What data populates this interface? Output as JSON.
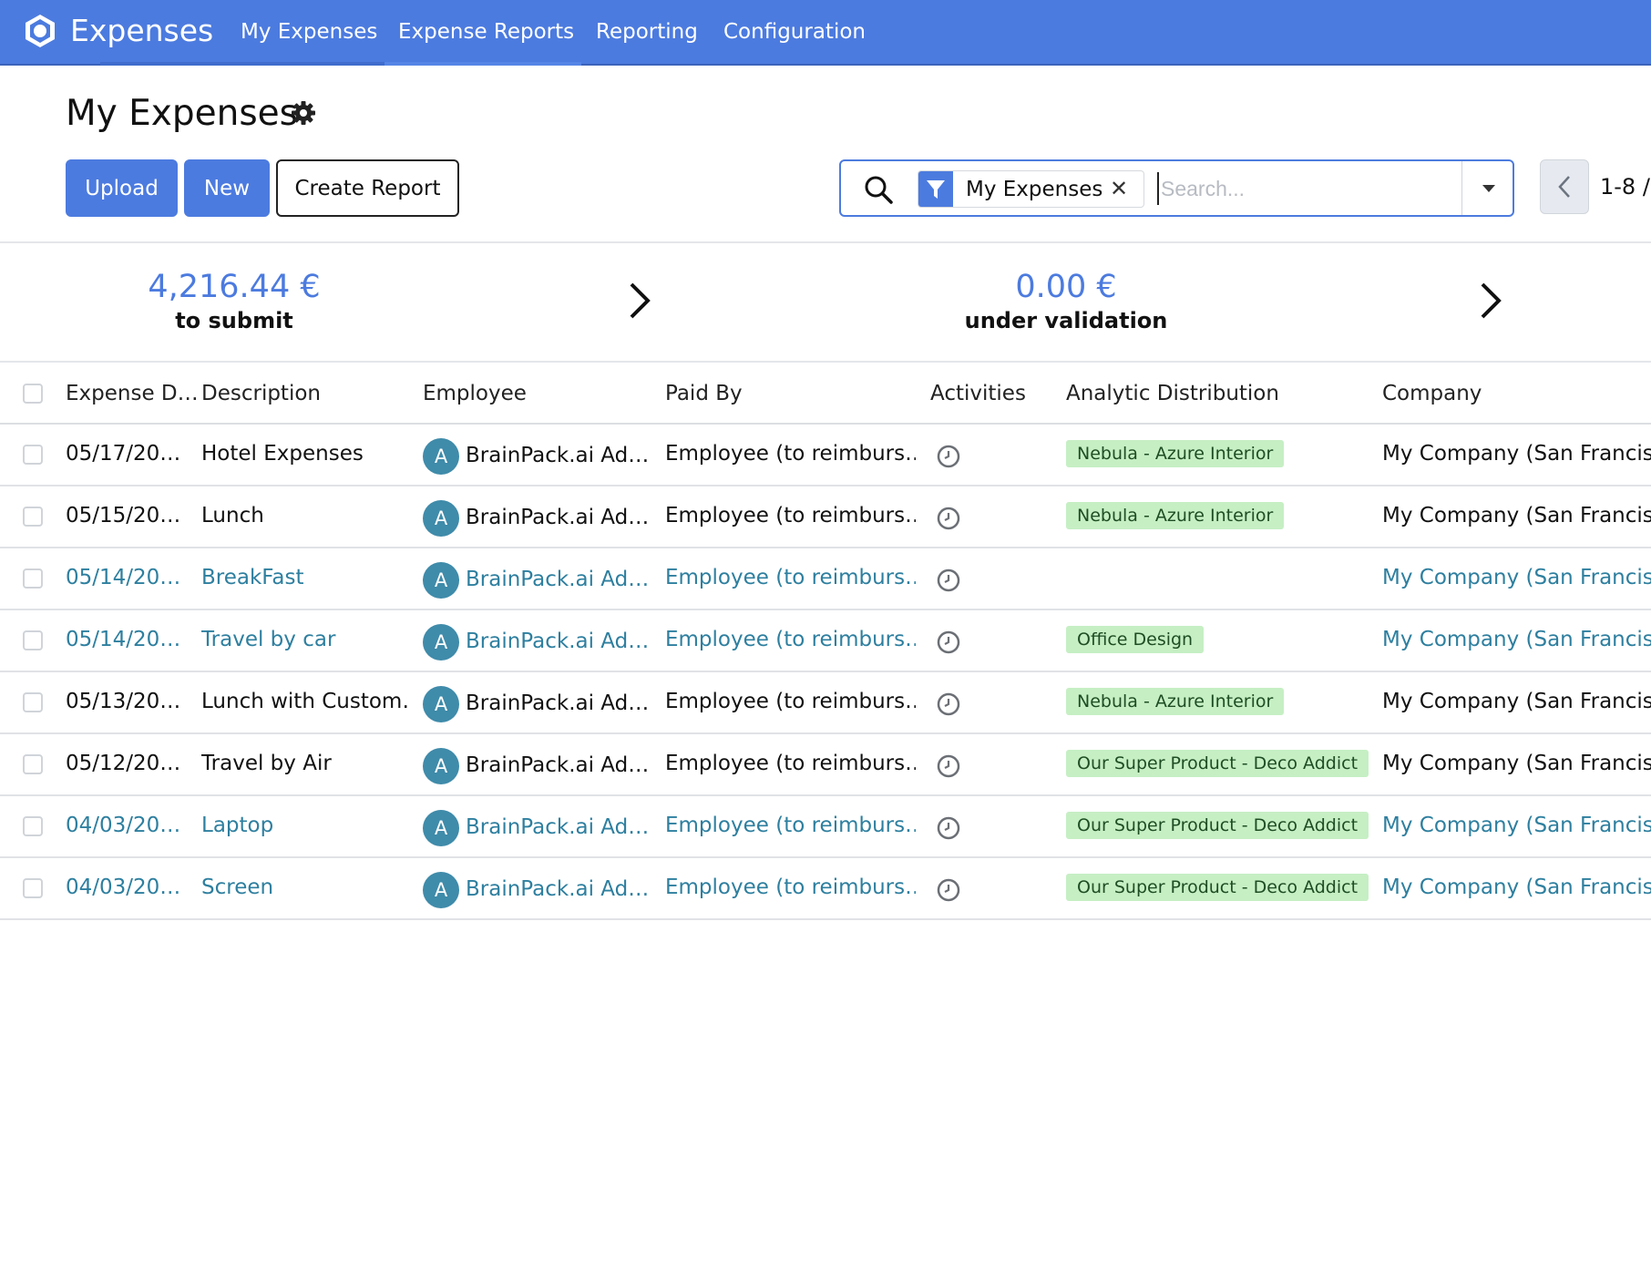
{
  "app": {
    "name": "Expenses"
  },
  "nav": [
    "My Expenses",
    "Expense Reports",
    "Reporting",
    "Configuration"
  ],
  "page": {
    "title": "My Expenses"
  },
  "buttons": {
    "upload": "Upload",
    "new": "New",
    "create_report": "Create Report"
  },
  "search": {
    "facet": "My Expenses",
    "placeholder": "Search..."
  },
  "pager": {
    "value": "1-8 /"
  },
  "summary": {
    "to_submit": {
      "amount": "4,216.44 €",
      "label": "to submit"
    },
    "under_validation": {
      "amount": "0.00 €",
      "label": "under validation"
    }
  },
  "columns": [
    "Expense D…",
    "Description",
    "Employee",
    "Paid By",
    "Activities",
    "Analytic Distribution",
    "Company"
  ],
  "rows": [
    {
      "date": "05/17/20…",
      "description": "Hotel Expenses",
      "avatar": "A",
      "employee": "BrainPack.ai Ad…",
      "paid_by": "Employee (to reimburs…",
      "analytic": "Nebula - Azure Interior",
      "company": "My Company (San Francisco",
      "style": "plain"
    },
    {
      "date": "05/15/20…",
      "description": "Lunch",
      "avatar": "A",
      "employee": "BrainPack.ai Ad…",
      "paid_by": "Employee (to reimburs…",
      "analytic": "Nebula - Azure Interior",
      "company": "My Company (San Francisco",
      "style": "plain"
    },
    {
      "date": "05/14/20…",
      "description": "BreakFast",
      "avatar": "A",
      "employee": "BrainPack.ai Ad…",
      "paid_by": "Employee (to reimburs…",
      "analytic": "",
      "company": "My Company (San Francisco",
      "style": "link"
    },
    {
      "date": "05/14/20…",
      "description": "Travel by car",
      "avatar": "A",
      "employee": "BrainPack.ai Ad…",
      "paid_by": "Employee (to reimburs…",
      "analytic": "Office Design",
      "company": "My Company (San Francisco",
      "style": "link"
    },
    {
      "date": "05/13/20…",
      "description": "Lunch with Custom…",
      "avatar": "A",
      "employee": "BrainPack.ai Ad…",
      "paid_by": "Employee (to reimburs…",
      "analytic": "Nebula - Azure Interior",
      "company": "My Company (San Francisco",
      "style": "plain"
    },
    {
      "date": "05/12/20…",
      "description": "Travel by Air",
      "avatar": "A",
      "employee": "BrainPack.ai Ad…",
      "paid_by": "Employee (to reimburs…",
      "analytic": "Our Super Product - Deco Addict",
      "company": "My Company (San Francisco",
      "style": "plain"
    },
    {
      "date": "04/03/20…",
      "description": "Laptop",
      "avatar": "A",
      "employee": "BrainPack.ai Ad…",
      "paid_by": "Employee (to reimburs…",
      "analytic": "Our Super Product - Deco Addict",
      "company": "My Company (San Francisco",
      "style": "link"
    },
    {
      "date": "04/03/20…",
      "description": "Screen",
      "avatar": "A",
      "employee": "BrainPack.ai Ad…",
      "paid_by": "Employee (to reimburs…",
      "analytic": "Our Super Product - Deco Addict",
      "company": "My Company (San Francisco",
      "style": "link"
    }
  ]
}
